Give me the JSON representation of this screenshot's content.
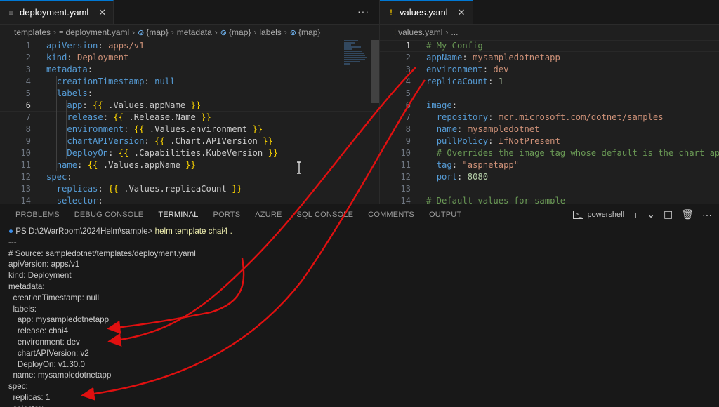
{
  "left_editor": {
    "tab": {
      "icon": "≡",
      "label": "deployment.yaml",
      "close": "✕"
    },
    "more": "···",
    "breadcrumb": [
      "templates",
      "deployment.yaml",
      "{map}",
      "metadata",
      "{map}",
      "labels",
      "{map}"
    ],
    "lines": [
      {
        "n": "1",
        "html": "<span class='k'>apiVersion</span>: <span class='s'>apps/v1</span>"
      },
      {
        "n": "2",
        "html": "<span class='k'>kind</span>: <span class='s'>Deployment</span>"
      },
      {
        "n": "3",
        "html": "<span class='k'>metadata</span>:"
      },
      {
        "n": "4",
        "html": "  <span class='k'>creationTimestamp</span>: <span class='nul'>null</span>"
      },
      {
        "n": "5",
        "html": "  <span class='k'>labels</span>:"
      },
      {
        "n": "6",
        "html": "    <span class='k'>app</span>: <span class='br'>{{</span> .Values.appName <span class='br'>}}</span>"
      },
      {
        "n": "7",
        "html": "    <span class='k'>release</span>: <span class='br'>{{</span> .Release.Name <span class='br'>}}</span>"
      },
      {
        "n": "8",
        "html": "    <span class='k'>environment</span>: <span class='br'>{{</span> .Values.environment <span class='br'>}}</span>"
      },
      {
        "n": "9",
        "html": "    <span class='k'>chartAPIVersion</span>: <span class='br'>{{</span> .Chart.APIVersion <span class='br'>}}</span>"
      },
      {
        "n": "10",
        "html": "    <span class='k'>DeployOn</span>: <span class='br'>{{</span> .Capabilities.KubeVersion <span class='br'>}}</span>"
      },
      {
        "n": "11",
        "html": "  <span class='k'>name</span>: <span class='br'>{{</span> .Values.appName <span class='br'>}}</span>"
      },
      {
        "n": "12",
        "html": "<span class='k'>spec</span>:"
      },
      {
        "n": "13",
        "html": "  <span class='k'>replicas</span>: <span class='br'>{{</span> .Values.replicaCount <span class='br'>}}</span>"
      },
      {
        "n": "14",
        "html": "  <span class='k'>selector</span>:"
      }
    ],
    "current_line": 6
  },
  "right_editor": {
    "tab": {
      "icon": "!",
      "label": "values.yaml",
      "close": "✕"
    },
    "breadcrumb": [
      "values.yaml",
      "..."
    ],
    "lines": [
      {
        "n": "1",
        "html": "<span class='cm'># My Config</span>"
      },
      {
        "n": "2",
        "html": "<span class='k'>appName</span>: <span class='s'>mysampledotnetapp</span>"
      },
      {
        "n": "3",
        "html": "<span class='k'>environment</span>: <span class='s'>dev</span>"
      },
      {
        "n": "4",
        "html": "<span class='k'>replicaCount</span>: <span class='num'>1</span>"
      },
      {
        "n": "5",
        "html": ""
      },
      {
        "n": "6",
        "html": "<span class='k'>image</span>:"
      },
      {
        "n": "7",
        "html": "  <span class='k'>repository</span>: <span class='s'>mcr.microsoft.com/dotnet/samples</span>"
      },
      {
        "n": "8",
        "html": "  <span class='k'>name</span>: <span class='s'>mysampledotnet</span>"
      },
      {
        "n": "9",
        "html": "  <span class='k'>pullPolicy</span>: <span class='s'>IfNotPresent</span>"
      },
      {
        "n": "10",
        "html": "  <span class='cm'># Overrides the image tag whose default is the chart appVe</span>"
      },
      {
        "n": "11",
        "html": "  <span class='k'>tag</span>: <span class='s'>\"aspnetapp\"</span>"
      },
      {
        "n": "12",
        "html": "  <span class='k'>port</span>: <span class='num'>8080</span>"
      },
      {
        "n": "13",
        "html": ""
      },
      {
        "n": "14",
        "html": "<span class='cm'># Default values for sample</span>"
      }
    ],
    "current_line": 1
  },
  "panel": {
    "tabs": [
      "PROBLEMS",
      "DEBUG CONSOLE",
      "TERMINAL",
      "PORTS",
      "AZURE",
      "SQL CONSOLE",
      "COMMENTS",
      "OUTPUT"
    ],
    "active_tab": "TERMINAL",
    "terminal_name": "powershell",
    "actions": {
      "add": "+",
      "chevron": "⌄",
      "split": "◫",
      "trash": "🗑",
      "more": "···"
    }
  },
  "terminal": {
    "prompt": "PS D:\\2WarRoom\\2024Helm\\sample>",
    "command": "helm template chai4 .",
    "output": [
      "---",
      "# Source: sampledotnet/templates/deployment.yaml",
      "apiVersion: apps/v1",
      "kind: Deployment",
      "metadata:",
      "  creationTimestamp: null",
      "  labels:",
      "    app: mysampledotnetapp",
      "    release: chai4",
      "    environment: dev",
      "    chartAPIVersion: v2",
      "    DeployOn: v1.30.0",
      "  name: mysampledotnetapp",
      "spec:",
      "  replicas: 1",
      "  selector:"
    ]
  },
  "colors": {
    "arrow": "#e01010",
    "accent": "#0078d4"
  }
}
